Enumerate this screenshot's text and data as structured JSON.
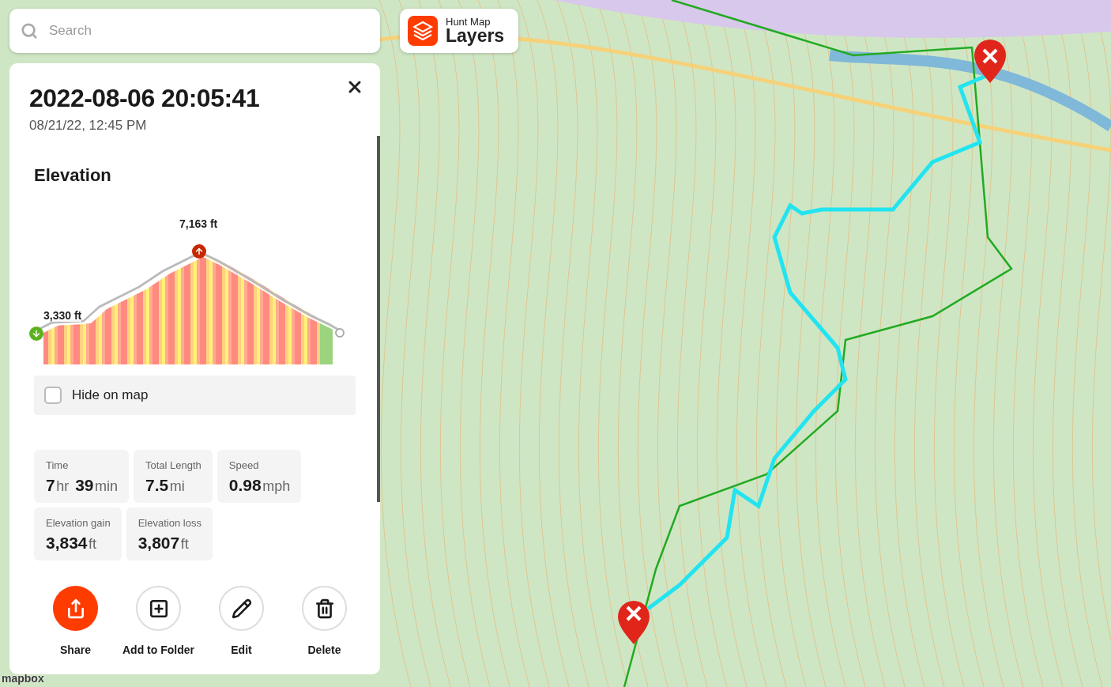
{
  "search": {
    "placeholder": "Search"
  },
  "layers_button": {
    "subtitle": "Hunt Map",
    "title": "Layers"
  },
  "panel": {
    "title": "2022-08-06 20:05:41",
    "subtitle": "08/21/22, 12:45 PM",
    "elevation": {
      "heading": "Elevation",
      "max_label": "7,163 ft",
      "min_label": "3,330 ft"
    },
    "hide_on_map": {
      "label": "Hide on map",
      "checked": false
    },
    "stats": [
      {
        "label": "Time",
        "parts": [
          {
            "value": "7",
            "unit": "hr"
          },
          {
            "value": "39",
            "unit": "min"
          }
        ]
      },
      {
        "label": "Total Length",
        "parts": [
          {
            "value": "7.5",
            "unit": "mi"
          }
        ]
      },
      {
        "label": "Speed",
        "parts": [
          {
            "value": "0.98",
            "unit": "mph"
          }
        ]
      },
      {
        "label": "Elevation gain",
        "parts": [
          {
            "value": "3,834",
            "unit": "ft"
          }
        ]
      },
      {
        "label": "Elevation loss",
        "parts": [
          {
            "value": "3,807",
            "unit": "ft"
          }
        ]
      }
    ],
    "actions": [
      {
        "kind": "share",
        "label": "Share",
        "primary": true
      },
      {
        "kind": "folder",
        "label": "Add to Folder",
        "primary": false
      },
      {
        "kind": "edit",
        "label": "Edit",
        "primary": false
      },
      {
        "kind": "delete",
        "label": "Delete",
        "primary": false
      }
    ]
  },
  "map": {
    "attribution": "mapbox"
  }
}
